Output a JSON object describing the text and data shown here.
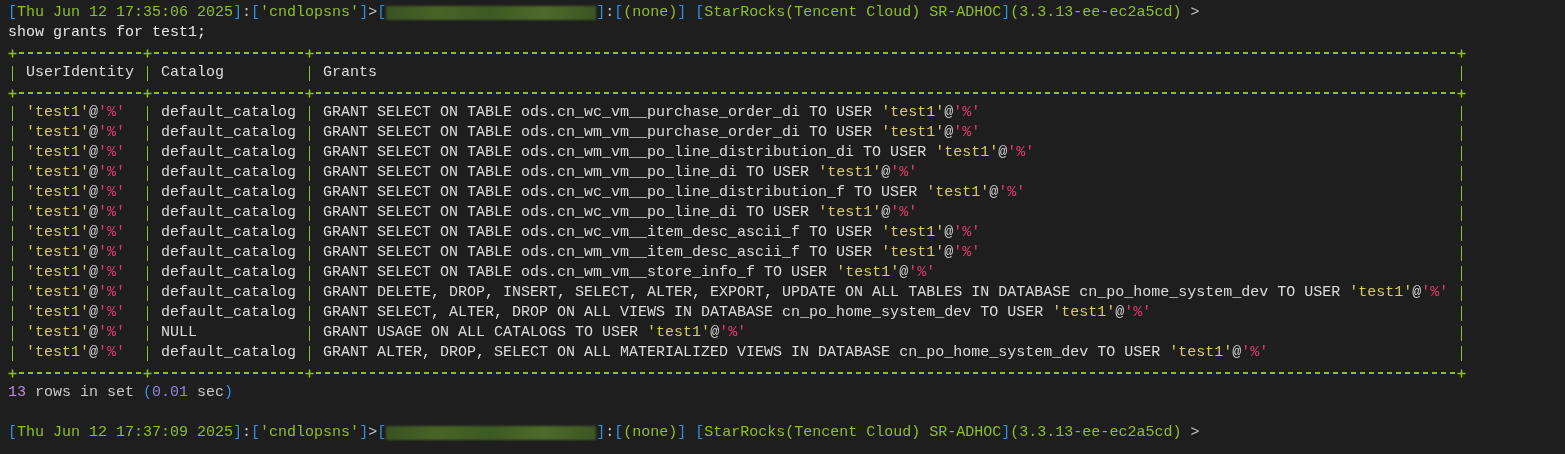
{
  "prompts": [
    {
      "before": [
        {
          "kind": "bracket",
          "text": "["
        },
        {
          "kind": "value",
          "text": "Thu Jun 12 17:35:06 2025"
        },
        {
          "kind": "bracket",
          "text": "]"
        },
        {
          "kind": "plain",
          "text": ":"
        },
        {
          "kind": "bracket",
          "text": "["
        },
        {
          "kind": "value",
          "text": "'cndlopsns'"
        },
        {
          "kind": "bracket",
          "text": "]"
        },
        {
          "kind": "plain",
          "text": ">"
        },
        {
          "kind": "bracket",
          "text": "["
        }
      ],
      "redacted": true,
      "after": [
        {
          "kind": "bracket",
          "text": "]"
        },
        {
          "kind": "plain",
          "text": ":"
        },
        {
          "kind": "bracket",
          "text": "["
        },
        {
          "kind": "value",
          "text": "(none)"
        },
        {
          "kind": "bracket",
          "text": "]"
        },
        {
          "kind": "bracket",
          "text": " ["
        },
        {
          "kind": "value",
          "text": "StarRocks(Tencent Cloud) SR-ADHOC"
        },
        {
          "kind": "bracket",
          "text": "]"
        },
        {
          "kind": "value",
          "text": "(3.3.13-ee-ec2a5cd)"
        },
        {
          "kind": "plain",
          "text": " >"
        }
      ],
      "command": "show grants for test1;"
    },
    {
      "before": [
        {
          "kind": "bracket",
          "text": "["
        },
        {
          "kind": "value",
          "text": "Thu Jun 12 17:37:09 2025"
        },
        {
          "kind": "bracket",
          "text": "]"
        },
        {
          "kind": "plain",
          "text": ":"
        },
        {
          "kind": "bracket",
          "text": "["
        },
        {
          "kind": "value",
          "text": "'cndlopsns'"
        },
        {
          "kind": "bracket",
          "text": "]"
        },
        {
          "kind": "plain",
          "text": ">"
        },
        {
          "kind": "bracket",
          "text": "["
        }
      ],
      "redacted": true,
      "after": [
        {
          "kind": "bracket",
          "text": "]"
        },
        {
          "kind": "plain",
          "text": ":"
        },
        {
          "kind": "bracket",
          "text": "["
        },
        {
          "kind": "value",
          "text": "(none)"
        },
        {
          "kind": "bracket",
          "text": "]"
        },
        {
          "kind": "bracket",
          "text": " ["
        },
        {
          "kind": "value",
          "text": "StarRocks(Tencent Cloud) SR-ADHOC"
        },
        {
          "kind": "bracket",
          "text": "]"
        },
        {
          "kind": "value",
          "text": "(3.3.13-ee-ec2a5cd)"
        },
        {
          "kind": "plain",
          "text": " >"
        }
      ]
    }
  ],
  "table": {
    "columns": [
      "UserIdentity",
      "Catalog",
      "Grants"
    ],
    "rows": [
      {
        "user_identity": {
          "user": "'test1'",
          "at": "@",
          "host": "'%'"
        },
        "catalog": "default_catalog",
        "grant": {
          "text": "GRANT SELECT ON TABLE ods.cn_wc_vm__purchase_order_di TO USER",
          "user": "'test1'",
          "at": "@",
          "host": "'%'"
        }
      },
      {
        "user_identity": {
          "user": "'test1'",
          "at": "@",
          "host": "'%'"
        },
        "catalog": "default_catalog",
        "grant": {
          "text": "GRANT SELECT ON TABLE ods.cn_wm_vm__purchase_order_di TO USER",
          "user": "'test1'",
          "at": "@",
          "host": "'%'"
        }
      },
      {
        "user_identity": {
          "user": "'test1'",
          "at": "@",
          "host": "'%'"
        },
        "catalog": "default_catalog",
        "grant": {
          "text": "GRANT SELECT ON TABLE ods.cn_wm_vm__po_line_distribution_di TO USER",
          "user": "'test1'",
          "at": "@",
          "host": "'%'"
        }
      },
      {
        "user_identity": {
          "user": "'test1'",
          "at": "@",
          "host": "'%'"
        },
        "catalog": "default_catalog",
        "grant": {
          "text": "GRANT SELECT ON TABLE ods.cn_wm_vm__po_line_di TO USER",
          "user": "'test1'",
          "at": "@",
          "host": "'%'"
        }
      },
      {
        "user_identity": {
          "user": "'test1'",
          "at": "@",
          "host": "'%'"
        },
        "catalog": "default_catalog",
        "grant": {
          "text": "GRANT SELECT ON TABLE ods.cn_wc_vm__po_line_distribution_f TO USER",
          "user": "'test1'",
          "at": "@",
          "host": "'%'"
        }
      },
      {
        "user_identity": {
          "user": "'test1'",
          "at": "@",
          "host": "'%'"
        },
        "catalog": "default_catalog",
        "grant": {
          "text": "GRANT SELECT ON TABLE ods.cn_wc_vm__po_line_di TO USER",
          "user": "'test1'",
          "at": "@",
          "host": "'%'"
        }
      },
      {
        "user_identity": {
          "user": "'test1'",
          "at": "@",
          "host": "'%'"
        },
        "catalog": "default_catalog",
        "grant": {
          "text": "GRANT SELECT ON TABLE ods.cn_wc_vm__item_desc_ascii_f TO USER",
          "user": "'test1'",
          "at": "@",
          "host": "'%'"
        }
      },
      {
        "user_identity": {
          "user": "'test1'",
          "at": "@",
          "host": "'%'"
        },
        "catalog": "default_catalog",
        "grant": {
          "text": "GRANT SELECT ON TABLE ods.cn_wm_vm__item_desc_ascii_f TO USER",
          "user": "'test1'",
          "at": "@",
          "host": "'%'"
        }
      },
      {
        "user_identity": {
          "user": "'test1'",
          "at": "@",
          "host": "'%'"
        },
        "catalog": "default_catalog",
        "grant": {
          "text": "GRANT SELECT ON TABLE ods.cn_wm_vm__store_info_f TO USER",
          "user": "'test1'",
          "at": "@",
          "host": "'%'"
        }
      },
      {
        "user_identity": {
          "user": "'test1'",
          "at": "@",
          "host": "'%'"
        },
        "catalog": "default_catalog",
        "grant": {
          "text": "GRANT DELETE, DROP, INSERT, SELECT, ALTER, EXPORT, UPDATE ON ALL TABLES IN DATABASE cn_po_home_system_dev TO USER",
          "user": "'test1'",
          "at": "@",
          "host": "'%'"
        }
      },
      {
        "user_identity": {
          "user": "'test1'",
          "at": "@",
          "host": "'%'"
        },
        "catalog": "default_catalog",
        "grant": {
          "text": "GRANT SELECT, ALTER, DROP ON ALL VIEWS IN DATABASE cn_po_home_system_dev TO USER",
          "user": "'test1'",
          "at": "@",
          "host": "'%'"
        }
      },
      {
        "user_identity": {
          "user": "'test1'",
          "at": "@",
          "host": "'%'"
        },
        "catalog": "NULL",
        "grant": {
          "text": "GRANT USAGE ON ALL CATALOGS TO USER",
          "user": "'test1'",
          "at": "@",
          "host": "'%'"
        }
      },
      {
        "user_identity": {
          "user": "'test1'",
          "at": "@",
          "host": "'%'"
        },
        "catalog": "default_catalog",
        "grant": {
          "text": "GRANT ALTER, DROP, SELECT ON ALL MATERIALIZED VIEWS IN DATABASE cn_po_home_system_dev TO USER",
          "user": "'test1'",
          "at": "@",
          "host": "'%'"
        }
      }
    ]
  },
  "summary": [
    {
      "kind": "number",
      "text": "13"
    },
    {
      "kind": "plain",
      "text": " rows in set "
    },
    {
      "kind": "paren",
      "text": "("
    },
    {
      "kind": "time",
      "text": "0.01"
    },
    {
      "kind": "plain",
      "text": " sec"
    },
    {
      "kind": "paren",
      "text": ")"
    }
  ]
}
